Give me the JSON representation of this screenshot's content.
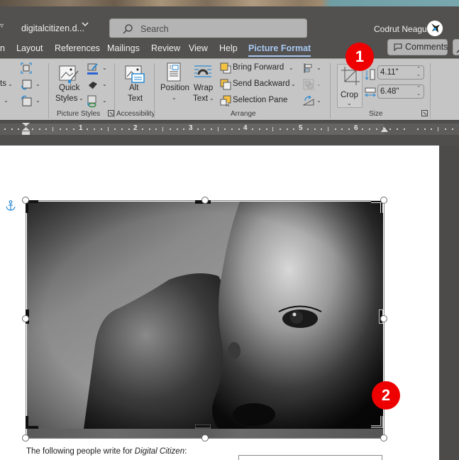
{
  "titlebar": {
    "document_name": "digitalcitizen.d...",
    "search_placeholder": "Search",
    "user_name": "Codrut Neagu"
  },
  "tabs": [
    {
      "label": "n",
      "active": false
    },
    {
      "label": "Layout",
      "active": false
    },
    {
      "label": "References",
      "active": false
    },
    {
      "label": "Mailings",
      "active": false
    },
    {
      "label": "Review",
      "active": false
    },
    {
      "label": "View",
      "active": false
    },
    {
      "label": "Help",
      "active": false
    },
    {
      "label": "Picture Format",
      "active": true
    }
  ],
  "comments_label": "Comments",
  "ribbon": {
    "adjust": {
      "partial_label_1": "ts",
      "icons": [
        "compress-pictures-icon",
        "change-picture-icon",
        "reset-picture-icon"
      ]
    },
    "picture_styles": {
      "quick_styles_line1": "Quick",
      "quick_styles_line2": "Styles",
      "group_label": "Picture Styles",
      "icons": [
        "picture-border-icon",
        "picture-effects-icon",
        "picture-layout-icon"
      ]
    },
    "accessibility": {
      "alt_text_line1": "Alt",
      "alt_text_line2": "Text",
      "group_label": "Accessibility"
    },
    "arrange": {
      "position_label": "Position",
      "wrap_text_line1": "Wrap",
      "wrap_text_line2": "Text",
      "bring_forward": "Bring Forward",
      "send_backward": "Send Backward",
      "selection_pane": "Selection Pane",
      "group_label": "Arrange"
    },
    "size": {
      "crop_label": "Crop",
      "height_value": "4.11\"",
      "width_value": "6.48\"",
      "group_label": "Size"
    }
  },
  "ruler": {
    "numbers": [
      "1",
      "2",
      "3",
      "4",
      "5",
      "6"
    ]
  },
  "document": {
    "body_text_prefix": "The following people write for ",
    "body_text_italic": "Digital Citizen",
    "body_text_suffix": ":"
  },
  "annotations": {
    "badge_1": "1",
    "badge_2": "2",
    "badge_color": "#ee0000"
  },
  "colors": {
    "active_tab": "#a8c7f0",
    "titlebar_bg": "#525150",
    "ribbon_bg": "#c5c5c5",
    "anchor": "#2a8ad4"
  }
}
